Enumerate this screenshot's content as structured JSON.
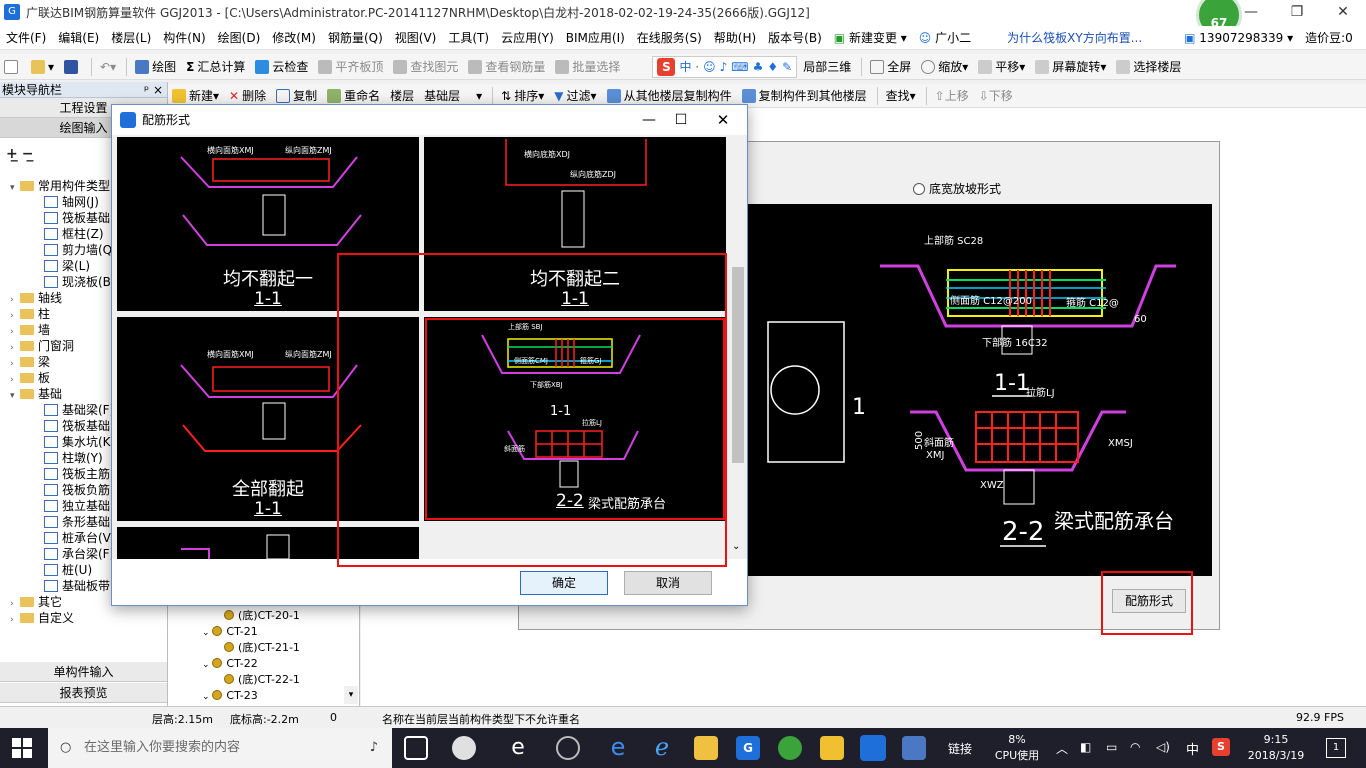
{
  "window": {
    "title": "广联达BIM钢筋算量软件 GGJ2013 - [C:\\Users\\Administrator.PC-20141127NRHM\\Desktop\\白龙村-2018-02-02-19-24-35(2666版).GGJ12]",
    "badge_number": "67"
  },
  "menu": {
    "items": [
      "文件(F)",
      "编辑(E)",
      "楼层(L)",
      "构件(N)",
      "绘图(D)",
      "修改(M)",
      "钢筋量(Q)",
      "视图(V)",
      "工具(T)",
      "云应用(Y)",
      "BIM应用(I)",
      "在线服务(S)",
      "帮助(H)",
      "版本号(B)"
    ],
    "new_change": "新建变更",
    "assistant": "广小二",
    "question_link": "为什么筏板XY方向布置...",
    "phone": "13907298339",
    "price_beans": "造价豆:0"
  },
  "toolbar1": {
    "draw": "绘图",
    "sum": "汇总计算",
    "cloud_check": "云检查",
    "flat_slab": "平齐板顶",
    "find_elem": "查找图元",
    "view_rebar": "查看钢筋量",
    "batch_select": "批量选择",
    "local_3d": "局部三维",
    "fullscreen": "全屏",
    "zoom": "缩放",
    "pan": "平移",
    "rotate": "屏幕旋转",
    "select_floor": "选择楼层"
  },
  "toolbar2": {
    "new": "新建",
    "delete": "删除",
    "copy": "复制",
    "rename": "重命名",
    "floor_label": "楼层",
    "floor_value": "基础层",
    "sort": "排序",
    "filter": "过滤",
    "copy_from": "从其他楼层复制构件",
    "copy_to": "复制构件到其他楼层",
    "find": "查找",
    "move_up": "上移",
    "move_down": "下移"
  },
  "leftnav": {
    "header": "模块导航栏",
    "pin": "ᵖ ×",
    "tab_project": "工程设置",
    "tab_draw": "绘图输入",
    "tab_single": "单构件输入",
    "tab_report": "报表预览",
    "tree": [
      {
        "label": "常用构件类型",
        "level": 0,
        "type": "folder",
        "exp": "▾"
      },
      {
        "label": "轴网(J)",
        "level": 1,
        "type": "cmp"
      },
      {
        "label": "筏板基础(M)",
        "level": 1,
        "type": "cmp"
      },
      {
        "label": "框柱(Z)",
        "level": 1,
        "type": "cmp"
      },
      {
        "label": "剪力墙(Q)",
        "level": 1,
        "type": "cmp"
      },
      {
        "label": "梁(L)",
        "level": 1,
        "type": "cmp"
      },
      {
        "label": "现浇板(B)",
        "level": 1,
        "type": "cmp"
      },
      {
        "label": "轴线",
        "level": 0,
        "type": "folder",
        "exp": "›"
      },
      {
        "label": "柱",
        "level": 0,
        "type": "folder",
        "exp": "›"
      },
      {
        "label": "墙",
        "level": 0,
        "type": "folder",
        "exp": "›"
      },
      {
        "label": "门窗洞",
        "level": 0,
        "type": "folder",
        "exp": "›"
      },
      {
        "label": "梁",
        "level": 0,
        "type": "folder",
        "exp": "›"
      },
      {
        "label": "板",
        "level": 0,
        "type": "folder",
        "exp": "›"
      },
      {
        "label": "基础",
        "level": 0,
        "type": "folder",
        "exp": "▾"
      },
      {
        "label": "基础梁(F)",
        "level": 1,
        "type": "cmp"
      },
      {
        "label": "筏板基础(M)",
        "level": 1,
        "type": "cmp"
      },
      {
        "label": "集水坑(K)",
        "level": 1,
        "type": "cmp"
      },
      {
        "label": "柱墩(Y)",
        "level": 1,
        "type": "cmp"
      },
      {
        "label": "筏板主筋(R)",
        "level": 1,
        "type": "cmp"
      },
      {
        "label": "筏板负筋(X)",
        "level": 1,
        "type": "cmp"
      },
      {
        "label": "独立基础(D)",
        "level": 1,
        "type": "cmp"
      },
      {
        "label": "条形基础(T)",
        "level": 1,
        "type": "cmp"
      },
      {
        "label": "桩承台(V)",
        "level": 1,
        "type": "cmp"
      },
      {
        "label": "承台梁(F)",
        "level": 1,
        "type": "cmp"
      },
      {
        "label": "桩(U)",
        "level": 1,
        "type": "cmp"
      },
      {
        "label": "基础板带(W)",
        "level": 1,
        "type": "cmp"
      },
      {
        "label": "其它",
        "level": 0,
        "type": "folder",
        "exp": "›"
      },
      {
        "label": "自定义",
        "level": 0,
        "type": "folder",
        "exp": "›"
      }
    ]
  },
  "comptree": {
    "items": [
      {
        "label": "(底)CT-20-1",
        "child": true
      },
      {
        "label": "CT-21",
        "child": false
      },
      {
        "label": "(底)CT-21-1",
        "child": true
      },
      {
        "label": "CT-22",
        "child": false
      },
      {
        "label": "(底)CT-22-1",
        "child": true
      },
      {
        "label": "CT-23",
        "child": false
      }
    ]
  },
  "workarea": {
    "radio_label": "底宽放坡形式",
    "section_1": "1-1",
    "section_2": "2-2",
    "caption": "梁式配筋承台",
    "side_num": "1",
    "rebar_top": "上部筋 SC28",
    "rebar_side": "侧面筋 C12@200",
    "rebar_hoop": "箍筋 C12@",
    "rebar_bottom": "下部筋 16C32",
    "rebar_tie": "拉筋LJ",
    "rebar_side2": "斜面筋",
    "label_xmj": "XMJ",
    "label_xmsj": "XMSJ",
    "label_xwz": "XWZ",
    "dim_500": "500",
    "dim_60": "60",
    "button": "配筋形式"
  },
  "dialog": {
    "title": "配筋形式",
    "options": [
      {
        "name": "均不翻起一",
        "section": "1-1"
      },
      {
        "name": "均不翻起二",
        "section": "1-1"
      },
      {
        "name": "全部翻起",
        "section": "1-1"
      },
      {
        "name": "梁式配筋承台",
        "section": "2-2",
        "section_top": "1-1"
      }
    ],
    "ok": "确定",
    "cancel": "取消",
    "small_labels": {
      "horiz": "横向面筋XMJ",
      "long": "纵向面筋ZMJ",
      "horiz_b": "横向底筋XDJ",
      "long_b": "纵向底筋ZDJ",
      "top": "上部筋 SBJ",
      "side": "侧面筋CMJ",
      "hoop": "箍筋GJ",
      "bot": "下部筋XBJ",
      "tie": "拉筋LJ",
      "slope": "斜面筋"
    }
  },
  "statusbar": {
    "floor_h": "层高:2.15m",
    "base_h": "底标高:-2.2m",
    "zero": "0",
    "message": "名称在当前层当前构件类型下不允许重名",
    "fps": "92.9 FPS"
  },
  "taskbar": {
    "search_placeholder": "在这里输入你要搜索的内容",
    "link_label": "链接",
    "cpu_pct": "8%",
    "cpu_label": "CPU使用",
    "ime": "中",
    "time": "9:15",
    "date": "2018/3/19",
    "notif": "1"
  }
}
